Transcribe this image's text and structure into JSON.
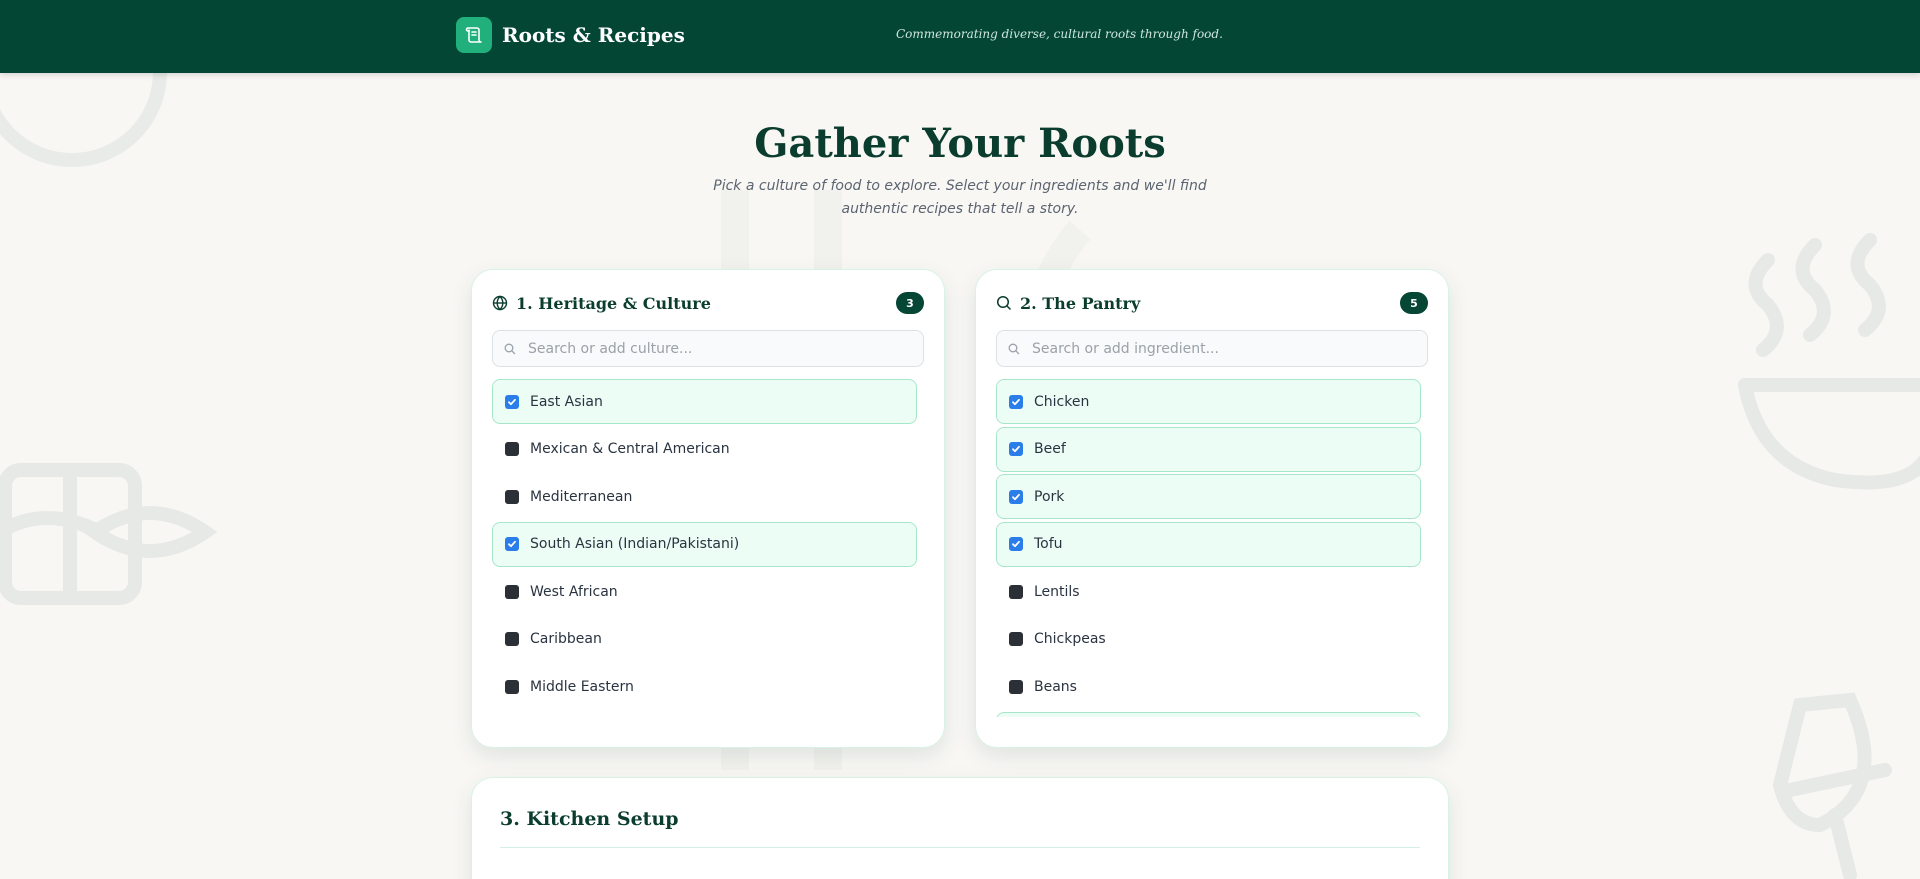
{
  "header": {
    "app_name": "Roots & Recipes",
    "tagline": "Commemorating diverse, cultural roots through food.",
    "logo_icon": "scroll-icon",
    "background_color": "#044634",
    "logo_color": "#21b07c"
  },
  "hero": {
    "title": "Gather Your Roots",
    "subtitle": "Pick a culture of food to explore. Select your ingredients and we'll find authentic recipes that tell a story."
  },
  "culture_card": {
    "title": "1. Heritage & Culture",
    "icon": "globe-icon",
    "count": "3",
    "search_placeholder": "Search or add culture...",
    "items": [
      {
        "label": "East Asian",
        "checked": true
      },
      {
        "label": "Mexican & Central American",
        "checked": false
      },
      {
        "label": "Mediterranean",
        "checked": false
      },
      {
        "label": "South Asian (Indian/Pakistani)",
        "checked": true
      },
      {
        "label": "West African",
        "checked": false
      },
      {
        "label": "Caribbean",
        "checked": false
      },
      {
        "label": "Middle Eastern",
        "checked": false
      }
    ]
  },
  "pantry_card": {
    "title": "2. The Pantry",
    "icon": "search-icon",
    "count": "5",
    "search_placeholder": "Search or add ingredient...",
    "items": [
      {
        "label": "Chicken",
        "checked": true
      },
      {
        "label": "Beef",
        "checked": true
      },
      {
        "label": "Pork",
        "checked": true
      },
      {
        "label": "Tofu",
        "checked": true
      },
      {
        "label": "Lentils",
        "checked": false
      },
      {
        "label": "Chickpeas",
        "checked": false
      },
      {
        "label": "Beans",
        "checked": false
      },
      {
        "label": "",
        "checked": true
      }
    ]
  },
  "kitchen_card": {
    "title": "3. Kitchen Setup"
  },
  "colors": {
    "accent_dark": "#054634",
    "checked_bg": "#ecfdf5",
    "checked_border": "#a7e7c9",
    "checkbox_checked": "#2b7de9",
    "page_bg": "#f8f7f4"
  }
}
